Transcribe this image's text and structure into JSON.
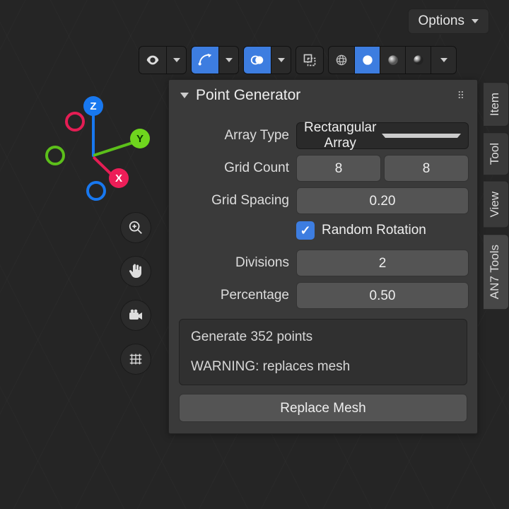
{
  "options_label": "Options",
  "panel": {
    "title": "Point Generator",
    "array_type_label": "Array Type",
    "array_type_value": "Rectangular Array",
    "grid_count_label": "Grid Count",
    "grid_count_x": "8",
    "grid_count_y": "8",
    "grid_spacing_label": "Grid Spacing",
    "grid_spacing_value": "0.20",
    "random_rotation_label": "Random Rotation",
    "random_rotation_checked": true,
    "divisions_label": "Divisions",
    "divisions_value": "2",
    "percentage_label": "Percentage",
    "percentage_value": "0.50",
    "info_line": "Generate 352 points",
    "warning_line": "WARNING: replaces mesh",
    "action_label": "Replace Mesh"
  },
  "gizmo": {
    "x": "X",
    "y": "Y",
    "z": "Z"
  },
  "vtabs": {
    "item": "Item",
    "tool": "Tool",
    "view": "View",
    "an7": "AN7 Tools"
  }
}
